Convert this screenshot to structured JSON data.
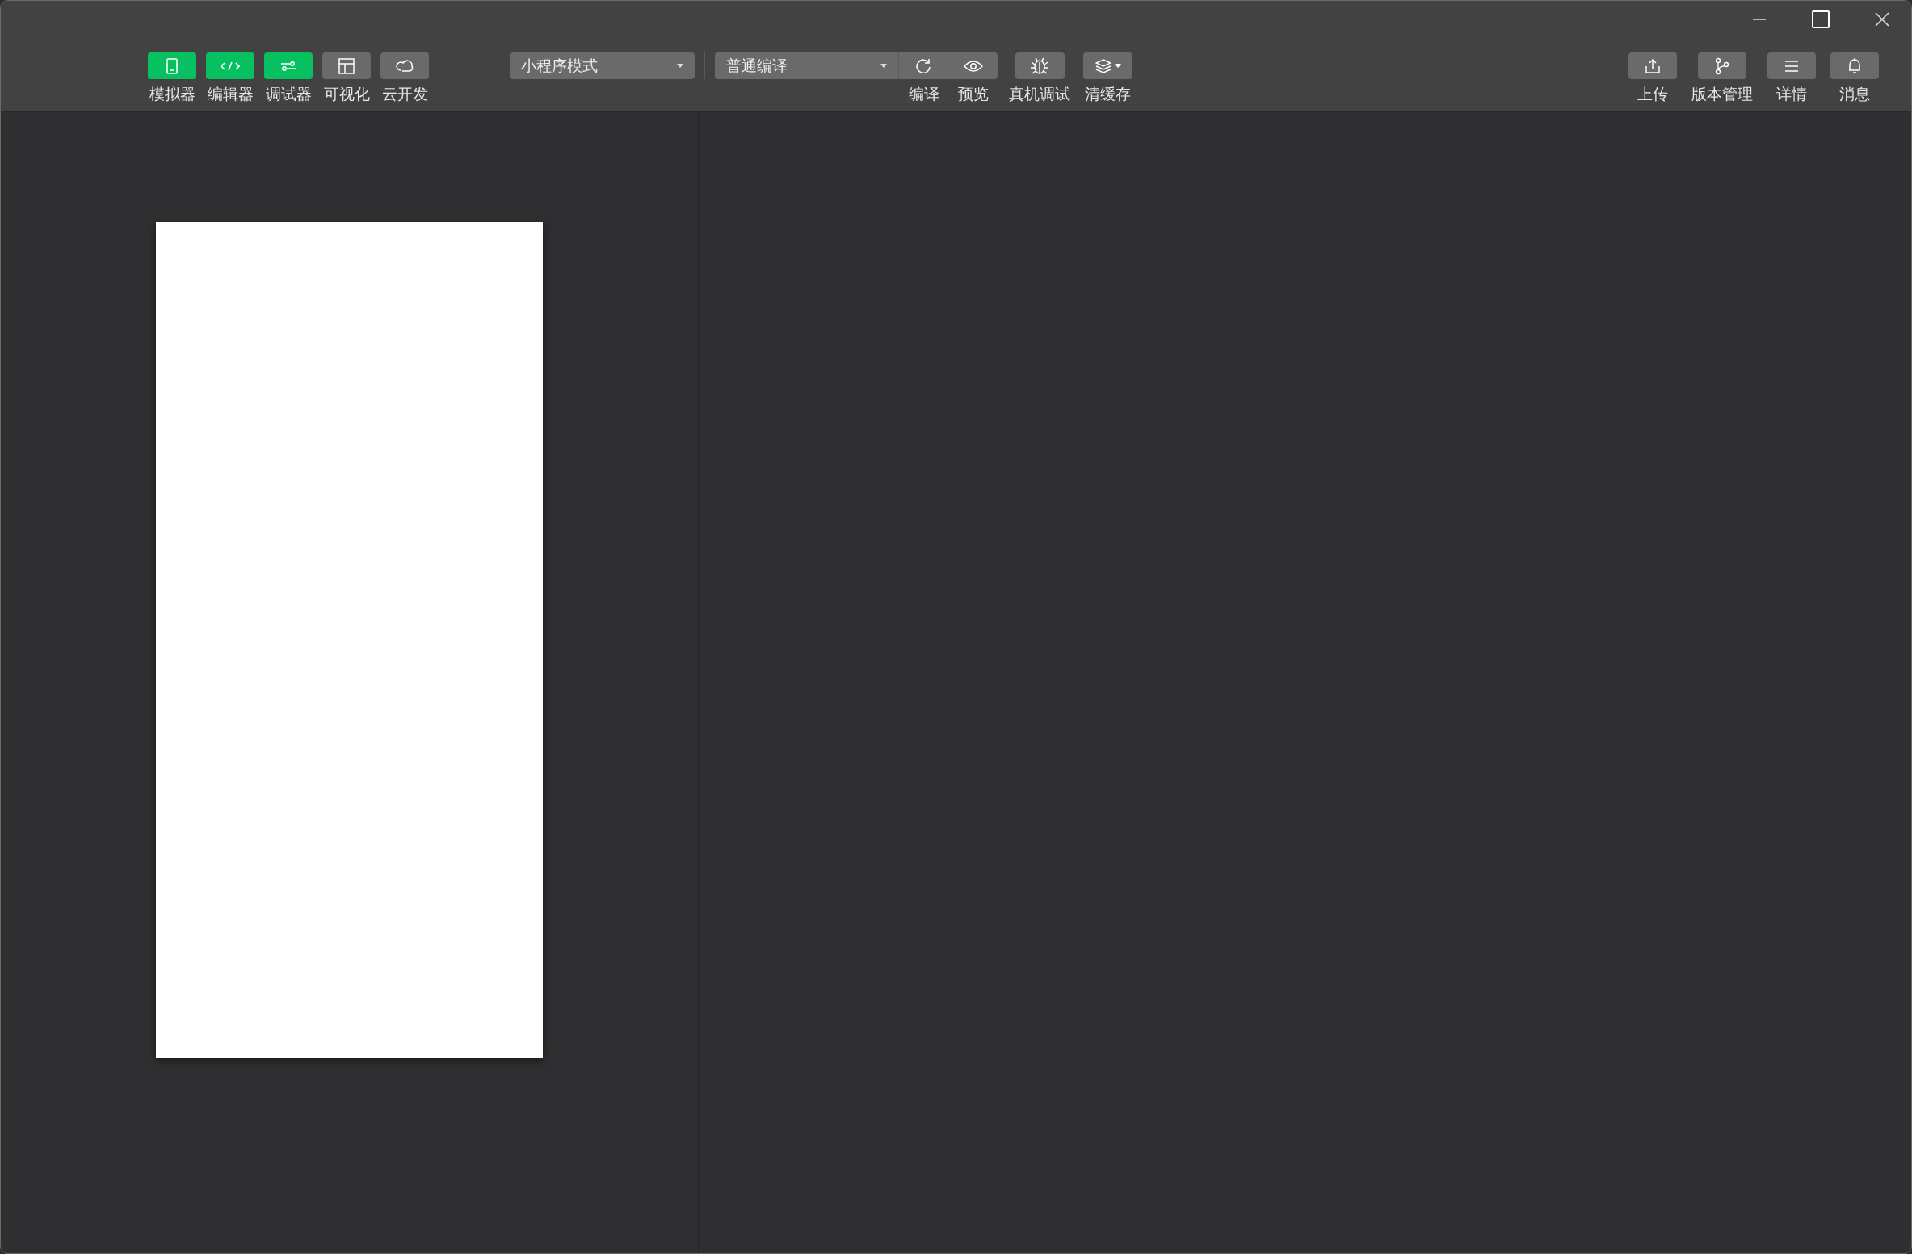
{
  "view_toggles": [
    {
      "label": "模拟器",
      "on": true
    },
    {
      "label": "编辑器",
      "on": true
    },
    {
      "label": "调试器",
      "on": true
    },
    {
      "label": "可视化",
      "on": false
    },
    {
      "label": "云开发",
      "on": false
    }
  ],
  "mode_select": {
    "value": "小程序模式"
  },
  "compile_select": {
    "value": "普通编译"
  },
  "compile_actions": [
    {
      "label": "编译"
    },
    {
      "label": "预览"
    }
  ],
  "tool_actions": [
    {
      "label": "真机调试"
    },
    {
      "label": "清缓存"
    }
  ],
  "right_actions": [
    {
      "label": "上传"
    },
    {
      "label": "版本管理"
    },
    {
      "label": "详情"
    },
    {
      "label": "消息"
    }
  ]
}
